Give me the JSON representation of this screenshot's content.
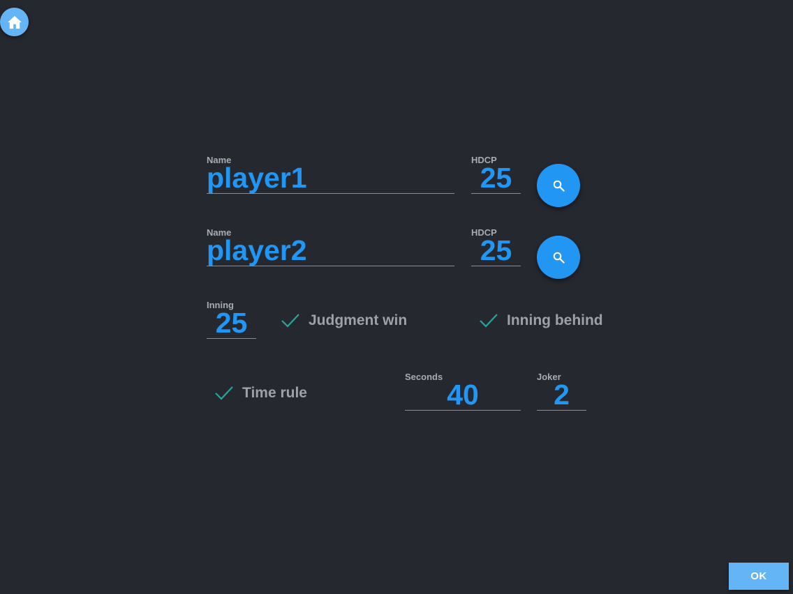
{
  "nav": {
    "home_icon": "home-icon"
  },
  "players": [
    {
      "name_label": "Name",
      "name_value": "player1",
      "hdcp_label": "HDCP",
      "hdcp_value": "25",
      "search_icon": "search-icon"
    },
    {
      "name_label": "Name",
      "name_value": "player2",
      "hdcp_label": "HDCP",
      "hdcp_value": "25",
      "search_icon": "search-icon"
    }
  ],
  "inning": {
    "label": "Inning",
    "value": "25"
  },
  "options": {
    "judgment_win": {
      "label": "Judgment win",
      "checked": true
    },
    "inning_behind": {
      "label": "Inning behind",
      "checked": true
    },
    "time_rule": {
      "label": "Time rule",
      "checked": true
    }
  },
  "seconds": {
    "label": "Seconds",
    "value": "40"
  },
  "joker": {
    "label": "Joker",
    "value": "2"
  },
  "actions": {
    "ok_label": "OK"
  },
  "colors": {
    "background": "#262830",
    "accent": "#2196f3",
    "accent_light": "#64b5f6",
    "check": "#26a69a",
    "label": "#a9abb0"
  }
}
